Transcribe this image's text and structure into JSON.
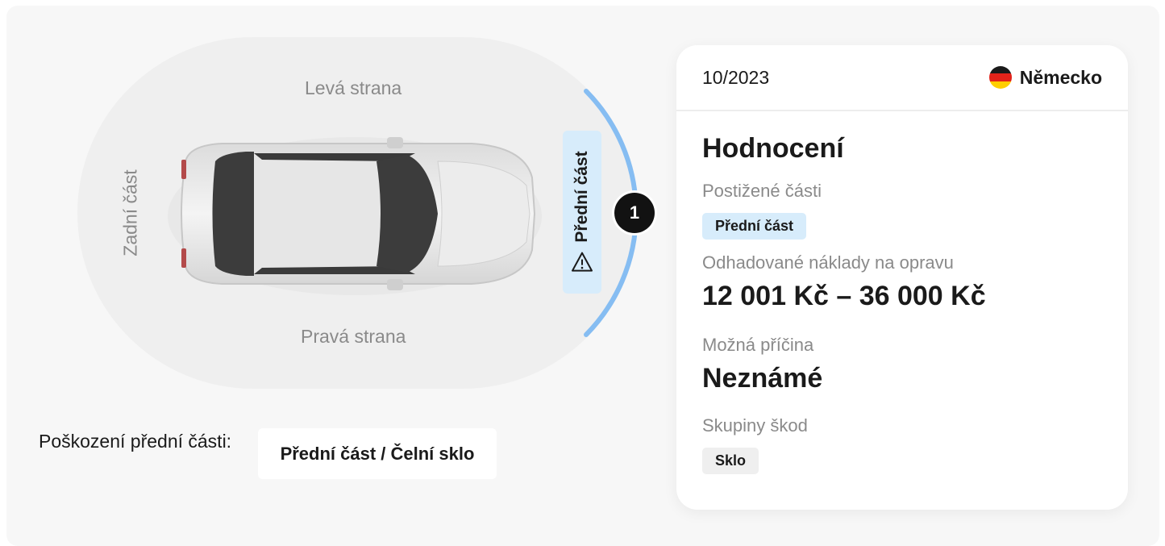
{
  "diagram": {
    "left_side_label": "Levá strana",
    "right_side_label": "Pravá strana",
    "rear_label": "Zadní část",
    "front_label": "Přední část",
    "marker_number": "1",
    "arc_color": "#86bdf2",
    "highlight_color": "#d7ecfb"
  },
  "damage": {
    "label": "Poškození přední části:",
    "value": "Přední část / Čelní sklo"
  },
  "card": {
    "date": "10/2023",
    "country": "Německo",
    "country_flag": "germany-flag-icon",
    "title": "Hodnocení",
    "affected_parts_label": "Postižené části",
    "affected_parts": [
      "Přední část"
    ],
    "cost_label": "Odhadované náklady na opravu",
    "cost_value": "12 001 Kč – 36 000 Kč",
    "cause_label": "Možná příčina",
    "cause_value": "Neznámé",
    "damage_groups_label": "Skupiny škod",
    "damage_groups": [
      "Sklo"
    ]
  }
}
